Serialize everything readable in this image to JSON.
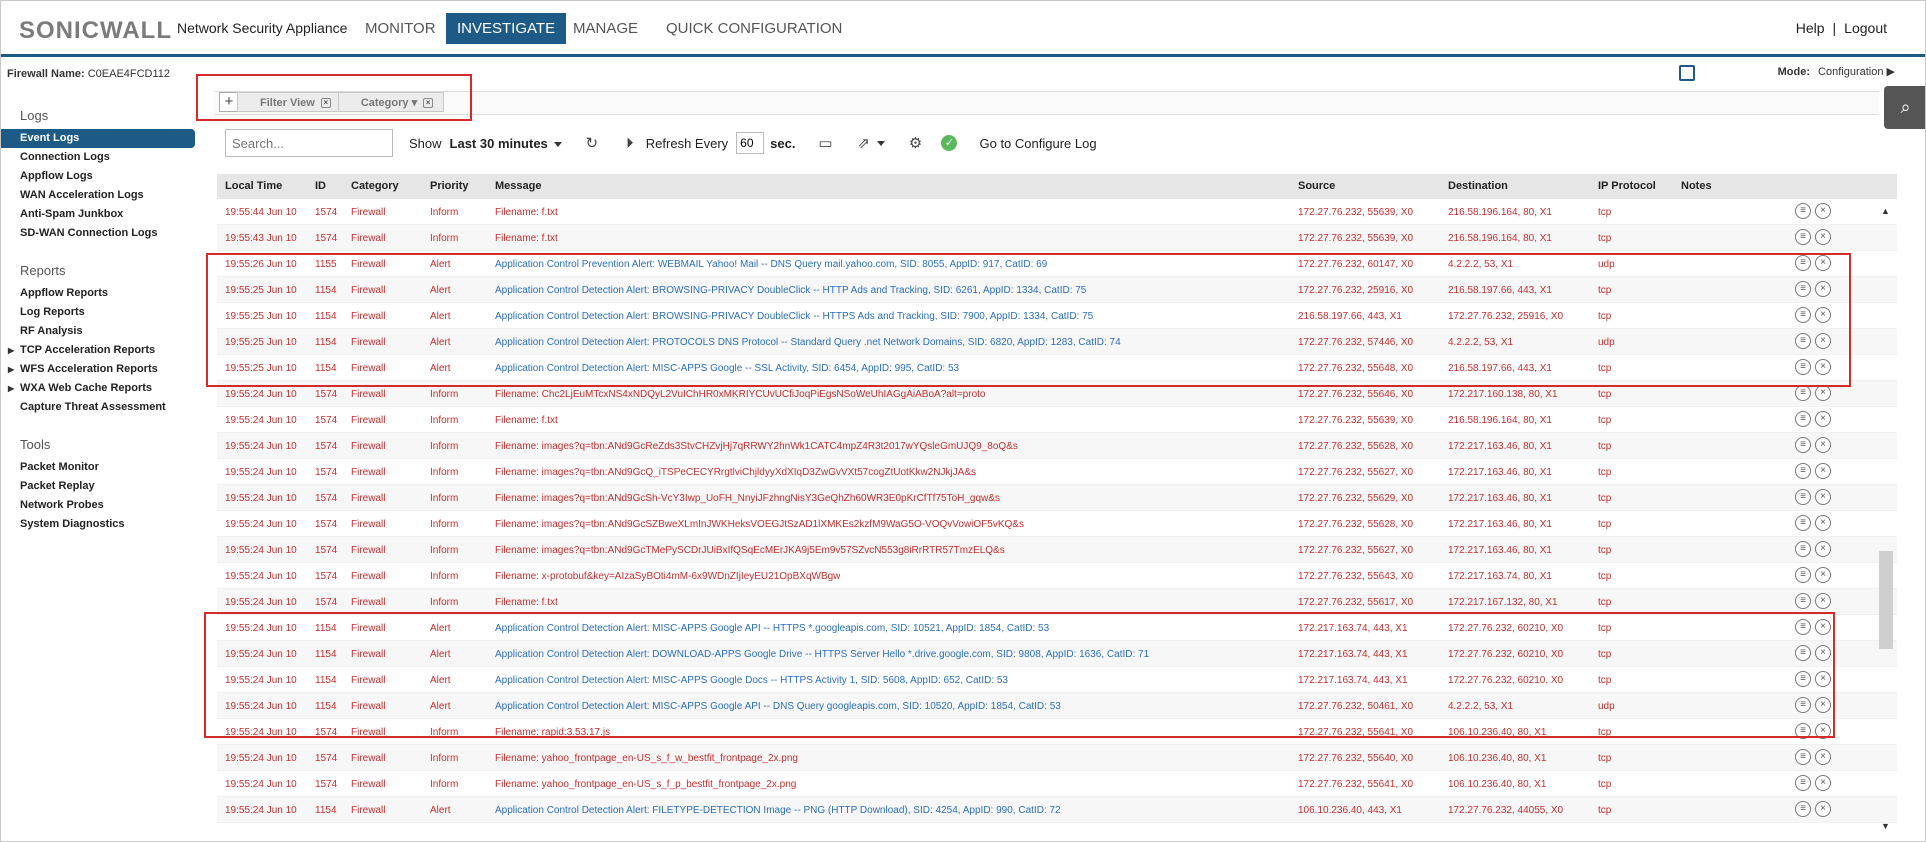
{
  "header": {
    "logo": "SONICWALL",
    "product": "Network Security Appliance",
    "tabs": [
      "MONITOR",
      "INVESTIGATE",
      "MANAGE",
      "QUICK CONFIGURATION"
    ],
    "active_tab": "INVESTIGATE",
    "help": "Help",
    "separator": "|",
    "logout": "Logout"
  },
  "firewall": {
    "label": "Firewall Name:",
    "value": "C0EAE4FCD112"
  },
  "mode": {
    "label": "Mode:",
    "value": "Configuration"
  },
  "filter": {
    "add": "+",
    "chips": [
      "Filter View",
      "Category"
    ]
  },
  "sidebar": {
    "logs_title": "Logs",
    "logs": [
      "Event Logs",
      "Connection Logs",
      "Appflow Logs",
      "WAN Acceleration Logs",
      "Anti-Spam Junkbox",
      "SD-WAN Connection Logs"
    ],
    "reports_title": "Reports",
    "reports": [
      "Appflow Reports",
      "Log Reports",
      "RF Analysis",
      "TCP Acceleration Reports",
      "WFS Acceleration Reports",
      "WXA Web Cache Reports",
      "Capture Threat Assessment"
    ],
    "tools_title": "Tools",
    "tools": [
      "Packet Monitor",
      "Packet Replay",
      "Network Probes",
      "System Diagnostics"
    ]
  },
  "toolbar": {
    "search_placeholder": "Search...",
    "show_label": "Show",
    "show_value": "Last 30 minutes",
    "refresh_label": "Refresh Every",
    "refresh_value": "60",
    "sec_label": "sec.",
    "configure_log": "Go to Configure Log"
  },
  "table": {
    "columns": [
      "Local Time",
      "ID",
      "Category",
      "Priority",
      "Message",
      "Source",
      "Destination",
      "IP Protocol",
      "Notes"
    ],
    "rows": [
      [
        "19:55:44 Jun 10",
        "1574",
        "Firewall",
        "Inform",
        "Filename: f.txt",
        "172.27.76.232, 55639, X0",
        "216.58.196.164, 80, X1",
        "tcp"
      ],
      [
        "19:55:43 Jun 10",
        "1574",
        "Firewall",
        "Inform",
        "Filename: f.txt",
        "172.27.76.232, 55639, X0",
        "216.58.196.164, 80, X1",
        "tcp"
      ],
      [
        "19:55:26 Jun 10",
        "1155",
        "Firewall",
        "Alert",
        "Application Control Prevention Alert: WEBMAIL Yahoo! Mail -- DNS Query mail.yahoo.com, SID: 8055, AppID: 917, CatID: 69",
        "172.27.76.232, 60147, X0",
        "4.2.2.2, 53, X1",
        "udp"
      ],
      [
        "19:55:25 Jun 10",
        "1154",
        "Firewall",
        "Alert",
        "Application Control Detection Alert: BROWSING-PRIVACY DoubleClick -- HTTP Ads and Tracking, SID: 6261, AppID: 1334, CatID: 75",
        "172.27.76.232, 25916, X0",
        "216.58.197.66, 443, X1",
        "tcp"
      ],
      [
        "19:55:25 Jun 10",
        "1154",
        "Firewall",
        "Alert",
        "Application Control Detection Alert: BROWSING-PRIVACY DoubleClick -- HTTPS Ads and Tracking, SID: 7900, AppID: 1334, CatID: 75",
        "216.58.197.66, 443, X1",
        "172.27.76.232, 25916, X0",
        "tcp"
      ],
      [
        "19:55:25 Jun 10",
        "1154",
        "Firewall",
        "Alert",
        "Application Control Detection Alert: PROTOCOLS DNS Protocol -- Standard Query .net Network Domains, SID: 6820, AppID: 1283, CatID: 74",
        "172.27.76.232, 57446, X0",
        "4.2.2.2, 53, X1",
        "udp"
      ],
      [
        "19:55:25 Jun 10",
        "1154",
        "Firewall",
        "Alert",
        "Application Control Detection Alert: MISC-APPS Google -- SSL Activity, SID: 6454, AppID: 995, CatID: 53",
        "172.27.76.232, 55648, X0",
        "216.58.197.66, 443, X1",
        "tcp"
      ],
      [
        "19:55:24 Jun 10",
        "1574",
        "Firewall",
        "Inform",
        "Filename: Chc2LjEuMTcxNS4xNDQyL2VuIChHR0xMKRIYCUvUCfiJoqPiEgsNSoWeUhIAGgAiABoA?alt=proto",
        "172.27.76.232, 55646, X0",
        "172.217.160.138, 80, X1",
        "tcp"
      ],
      [
        "19:55:24 Jun 10",
        "1574",
        "Firewall",
        "Inform",
        "Filename: f.txt",
        "172.27.76.232, 55639, X0",
        "216.58.196.164, 80, X1",
        "tcp"
      ],
      [
        "19:55:24 Jun 10",
        "1574",
        "Firewall",
        "Inform",
        "Filename: images?q=tbn:ANd9GcReZds3StvCHZvjHj7qRRWY2hnWk1CATC4mpZ4R3t2017wYQsleGmUJQ9_8oQ&s",
        "172.27.76.232, 55628, X0",
        "172.217.163.46, 80, X1",
        "tcp"
      ],
      [
        "19:55:24 Jun 10",
        "1574",
        "Firewall",
        "Inform",
        "Filename: images?q=tbn:ANd9GcQ_iTSPeCECYRrgtlviChjldyyXdXIqD3ZwGvVXt57cogZtUotKkw2NJkjJA&s",
        "172.27.76.232, 55627, X0",
        "172.217.163.46, 80, X1",
        "tcp"
      ],
      [
        "19:55:24 Jun 10",
        "1574",
        "Firewall",
        "Inform",
        "Filename: images?q=tbn:ANd9GcSh-VcY3Iwp_UoFH_NnyiJFzhngNisY3GeQhZh60WR3E0pKrCfTf75ToH_gqw&s",
        "172.27.76.232, 55629, X0",
        "172.217.163.46, 80, X1",
        "tcp"
      ],
      [
        "19:55:24 Jun 10",
        "1574",
        "Firewall",
        "Inform",
        "Filename: images?q=tbn:ANd9GcSZBweXLmInJWKHeksVOEGJtSzAD1lXMKEs2kzfM9WaG5O-VOQvVowiOF5vKQ&s",
        "172.27.76.232, 55628, X0",
        "172.217.163.46, 80, X1",
        "tcp"
      ],
      [
        "19:55:24 Jun 10",
        "1574",
        "Firewall",
        "Inform",
        "Filename: images?q=tbn:ANd9GcTMePySCDrJUiBxIfQSqEcMErJKA9j5Em9v57SZvcN553g8iRrRTR57TmzELQ&s",
        "172.27.76.232, 55627, X0",
        "172.217.163.46, 80, X1",
        "tcp"
      ],
      [
        "19:55:24 Jun 10",
        "1574",
        "Firewall",
        "Inform",
        "Filename: x-protobuf&key=AIzaSyBOti4mM-6x9WDnZIjIeyEU21OpBXqWBgw",
        "172.27.76.232, 55643, X0",
        "172.217.163.74, 80, X1",
        "tcp"
      ],
      [
        "19:55:24 Jun 10",
        "1574",
        "Firewall",
        "Inform",
        "Filename: f.txt",
        "172.27.76.232, 55617, X0",
        "172.217.167.132, 80, X1",
        "tcp"
      ],
      [
        "19:55:24 Jun 10",
        "1154",
        "Firewall",
        "Alert",
        "Application Control Detection Alert: MISC-APPS Google API -- HTTPS *.googleapis.com, SID: 10521, AppID: 1854, CatID: 53",
        "172.217.163.74, 443, X1",
        "172.27.76.232, 60210, X0",
        "tcp"
      ],
      [
        "19:55:24 Jun 10",
        "1154",
        "Firewall",
        "Alert",
        "Application Control Detection Alert: DOWNLOAD-APPS Google Drive -- HTTPS Server Hello *.drive.google.com, SID: 9808, AppID: 1636, CatID: 71",
        "172.217.163.74, 443, X1",
        "172.27.76.232, 60210, X0",
        "tcp"
      ],
      [
        "19:55:24 Jun 10",
        "1154",
        "Firewall",
        "Alert",
        "Application Control Detection Alert: MISC-APPS Google Docs -- HTTPS Activity 1, SID: 5608, AppID: 652, CatID: 53",
        "172.217.163.74, 443, X1",
        "172.27.76.232, 60210, X0",
        "tcp"
      ],
      [
        "19:55:24 Jun 10",
        "1154",
        "Firewall",
        "Alert",
        "Application Control Detection Alert: MISC-APPS Google API -- DNS Query googleapis.com, SID: 10520, AppID: 1854, CatID: 53",
        "172.27.76.232, 50461, X0",
        "4.2.2.2, 53, X1",
        "udp"
      ],
      [
        "19:55:24 Jun 10",
        "1574",
        "Firewall",
        "Inform",
        "Filename: rapid:3.53.17.js",
        "172.27.76.232, 55641, X0",
        "106.10.236.40, 80, X1",
        "tcp"
      ],
      [
        "19:55:24 Jun 10",
        "1574",
        "Firewall",
        "Inform",
        "Filename: yahoo_frontpage_en-US_s_f_w_bestfit_frontpage_2x.png",
        "172.27.76.232, 55640, X0",
        "106.10.236.40, 80, X1",
        "tcp"
      ],
      [
        "19:55:24 Jun 10",
        "1574",
        "Firewall",
        "Inform",
        "Filename: yahoo_frontpage_en-US_s_f_p_bestfit_frontpage_2x.png",
        "172.27.76.232, 55641, X0",
        "106.10.236.40, 80, X1",
        "tcp"
      ],
      [
        "19:55:24 Jun 10",
        "1154",
        "Firewall",
        "Alert",
        "Application Control Detection Alert: FILETYPE-DETECTION Image -- PNG (HTTP Download), SID: 4254, AppID: 990, CatID: 72",
        "106.10.236.40, 443, X1",
        "172.27.76.232, 44055, X0",
        "tcp"
      ]
    ]
  },
  "colors": {
    "brand": "#1d5a85",
    "row_text": "#c62d2d",
    "alert_message": "#2a6ebb",
    "highlight_box": "#d42a2a"
  }
}
